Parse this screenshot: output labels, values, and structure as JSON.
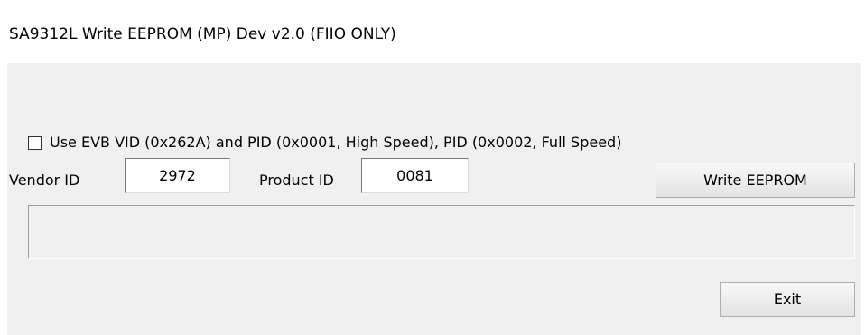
{
  "window": {
    "title": "SA9312L Write EEPROM (MP) Dev v2.0 (FIIO ONLY)"
  },
  "evb_option": {
    "label": "Use EVB VID (0x262A) and PID (0x0001, High Speed), PID (0x0002, Full Speed)",
    "checked": false
  },
  "vendor": {
    "label": "Vendor ID",
    "value": "2972"
  },
  "product": {
    "label": "Product ID",
    "value": "0081"
  },
  "buttons": {
    "write": "Write EEPROM",
    "exit": "Exit"
  },
  "status": {
    "text": ""
  }
}
